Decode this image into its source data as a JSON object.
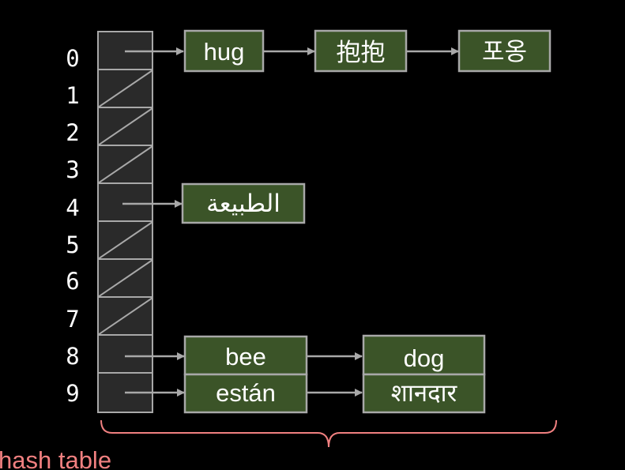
{
  "hash_table": {
    "caption": "hash table",
    "indices": [
      "0",
      "1",
      "2",
      "3",
      "4",
      "5",
      "6",
      "7",
      "8",
      "9"
    ],
    "empty_slots": [
      1,
      2,
      3,
      5,
      6,
      7
    ]
  },
  "chains": {
    "slot_0": [
      "hug",
      "抱抱",
      "포옹"
    ],
    "slot_4": [
      "الطبيعة"
    ],
    "slot_8": [
      "bee",
      "dog"
    ],
    "slot_9": [
      "están",
      "शानदार"
    ]
  },
  "colors": {
    "background": "#000000",
    "slot_fill": "#2a2a2a",
    "slot_border": "#a8a8a8",
    "node_fill": "#3b5428",
    "node_border": "#a8a8a8",
    "arrow": "#a8a8a8",
    "caption_and_brace": "#f08080"
  }
}
